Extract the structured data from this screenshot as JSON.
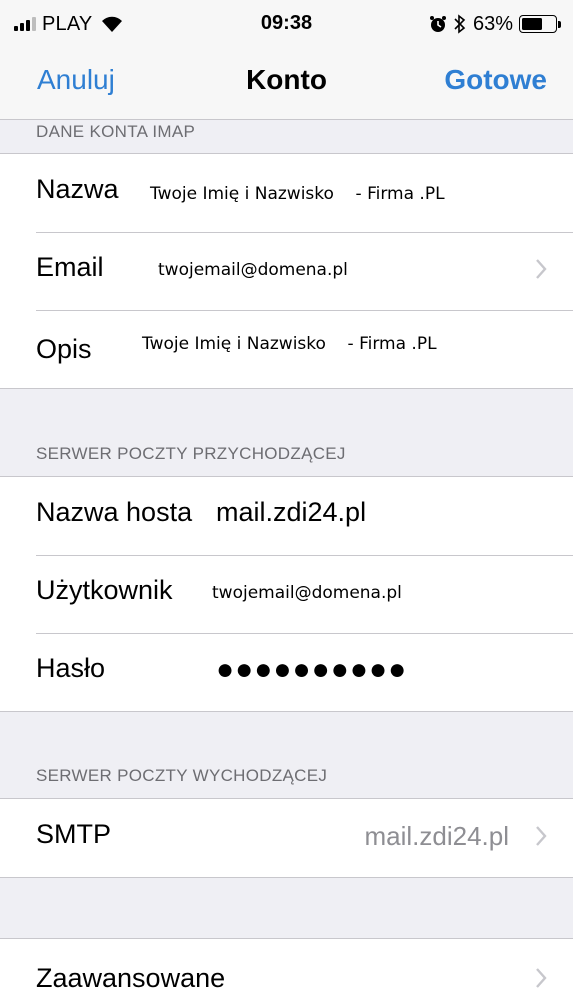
{
  "status_bar": {
    "carrier": "PLAY",
    "time": "09:38",
    "battery_percent_label": "63%",
    "battery_level": 0.63,
    "icons": [
      "signal-icon",
      "wifi-icon",
      "alarm-icon",
      "bluetooth-icon",
      "battery-icon"
    ]
  },
  "nav": {
    "left": "Anuluj",
    "title": "Konto",
    "right": "Gotowe",
    "accent_color": "#2f7fd3"
  },
  "account": {
    "header": "DANE KONTA IMAP",
    "name_label": "Nazwa",
    "name_value": "Twoje Imię i Nazwisko    - Firma .PL",
    "email_label": "Email",
    "email_value": "twojemail@domena.pl",
    "desc_label": "Opis",
    "desc_value": "Twoje Imię i Nazwisko    - Firma .PL"
  },
  "incoming": {
    "header": "SERWER POCZTY PRZYCHODZĄCEJ",
    "host_label": "Nazwa hosta",
    "host_value": "mail.zdi24.pl",
    "user_label": "Użytkownik",
    "user_value": "twojemail@domena.pl",
    "password_label": "Hasło",
    "password_value": "●●●●●●●●●●"
  },
  "outgoing": {
    "header": "SERWER POCZTY WYCHODZĄCEJ",
    "smtp_label": "SMTP",
    "smtp_value": "mail.zdi24.pl"
  },
  "advanced": {
    "label": "Zaawansowane"
  }
}
